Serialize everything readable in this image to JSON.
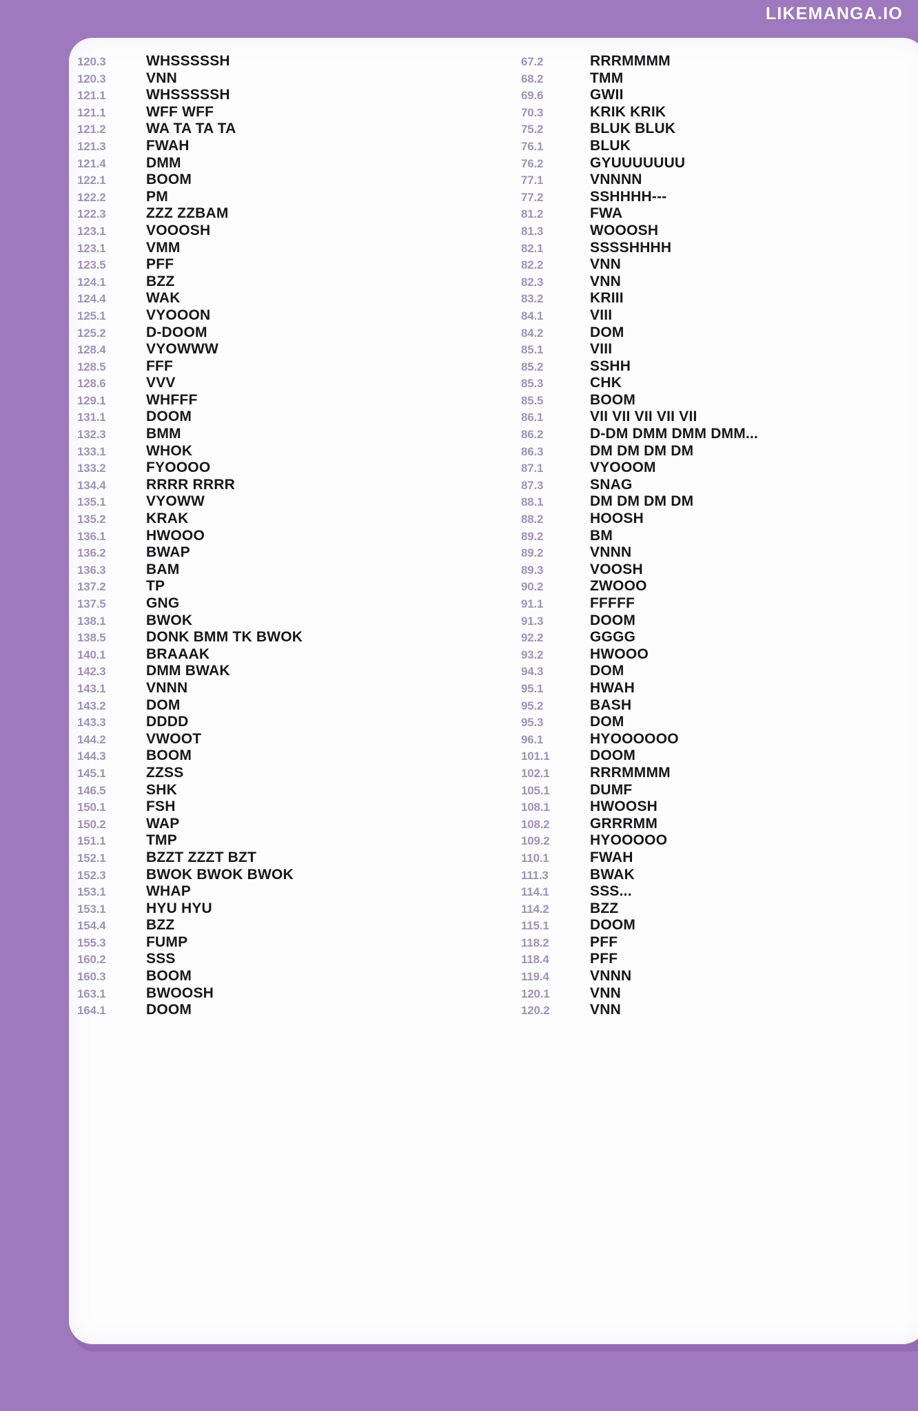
{
  "watermark": "LIKEMANGA.IO",
  "colors": {
    "background": "#9e79bd",
    "sheet": "#fdfdfd",
    "reference_text": "#9f93bb",
    "sfx_text": "#17171a",
    "watermark_text": "#ffffff"
  },
  "columns": {
    "left": [
      {
        "ref": "120.3",
        "sfx": "WHSSSSSH"
      },
      {
        "ref": "120.3",
        "sfx": "VNN"
      },
      {
        "ref": "121.1",
        "sfx": "WHSSSSSH"
      },
      {
        "ref": "121.1",
        "sfx": "WFF WFF"
      },
      {
        "ref": "121.2",
        "sfx": "WA TA TA TA"
      },
      {
        "ref": "121.3",
        "sfx": "FWAH"
      },
      {
        "ref": "121.4",
        "sfx": "DMM"
      },
      {
        "ref": "122.1",
        "sfx": "BOOM"
      },
      {
        "ref": "122.2",
        "sfx": "PM"
      },
      {
        "ref": "122.3",
        "sfx": "ZZZ ZZBAM"
      },
      {
        "ref": "123.1",
        "sfx": "VOOOSH"
      },
      {
        "ref": "123.1",
        "sfx": "VMM"
      },
      {
        "ref": "123.5",
        "sfx": "PFF"
      },
      {
        "ref": "124.1",
        "sfx": "BZZ"
      },
      {
        "ref": "124.4",
        "sfx": "WAK"
      },
      {
        "ref": "125.1",
        "sfx": "VYOOON"
      },
      {
        "ref": "125.2",
        "sfx": "D-DOOM"
      },
      {
        "ref": "128.4",
        "sfx": "VYOWWW"
      },
      {
        "ref": "128.5",
        "sfx": "FFF"
      },
      {
        "ref": "128.6",
        "sfx": "VVV"
      },
      {
        "ref": "129.1",
        "sfx": "WHFFF"
      },
      {
        "ref": "131.1",
        "sfx": "DOOM"
      },
      {
        "ref": "132.3",
        "sfx": "BMM"
      },
      {
        "ref": "133.1",
        "sfx": "WHOK"
      },
      {
        "ref": "133.2",
        "sfx": "FYOOOO"
      },
      {
        "ref": "134.4",
        "sfx": "RRRR RRRR"
      },
      {
        "ref": "135.1",
        "sfx": "VYOWW"
      },
      {
        "ref": "135.2",
        "sfx": "KRAK"
      },
      {
        "ref": "136.1",
        "sfx": "HWOOO"
      },
      {
        "ref": "136.2",
        "sfx": "BWAP"
      },
      {
        "ref": "136.3",
        "sfx": "BAM"
      },
      {
        "ref": "137.2",
        "sfx": "TP"
      },
      {
        "ref": "137.5",
        "sfx": "GNG"
      },
      {
        "ref": "138.1",
        "sfx": "BWOK"
      },
      {
        "ref": "138.5",
        "sfx": "DONK BMM TK BWOK"
      },
      {
        "ref": "140.1",
        "sfx": "BRAAAK"
      },
      {
        "ref": "142.3",
        "sfx": "DMM BWAK"
      },
      {
        "ref": "143.1",
        "sfx": "VNNN"
      },
      {
        "ref": "143.2",
        "sfx": "DOM"
      },
      {
        "ref": "143.3",
        "sfx": "DDDD"
      },
      {
        "ref": "144.2",
        "sfx": "VWOOT"
      },
      {
        "ref": "144.3",
        "sfx": "BOOM"
      },
      {
        "ref": "145.1",
        "sfx": "ZZSS"
      },
      {
        "ref": "146.5",
        "sfx": "SHK"
      },
      {
        "ref": "150.1",
        "sfx": "FSH"
      },
      {
        "ref": "150.2",
        "sfx": "WAP"
      },
      {
        "ref": "151.1",
        "sfx": "TMP"
      },
      {
        "ref": "152.1",
        "sfx": "BZZT ZZZT BZT"
      },
      {
        "ref": "152.3",
        "sfx": "BWOK BWOK BWOK"
      },
      {
        "ref": "153.1",
        "sfx": "WHAP"
      },
      {
        "ref": "153.1",
        "sfx": "HYU HYU"
      },
      {
        "ref": "154.4",
        "sfx": "BZZ"
      },
      {
        "ref": "155.3",
        "sfx": "FUMP"
      },
      {
        "ref": "160.2",
        "sfx": "SSS"
      },
      {
        "ref": "160.3",
        "sfx": "BOOM"
      },
      {
        "ref": "163.1",
        "sfx": "BWOOSH"
      },
      {
        "ref": "164.1",
        "sfx": "DOOM"
      }
    ],
    "right": [
      {
        "ref": "67.2",
        "sfx": "RRRMMMM"
      },
      {
        "ref": "68.2",
        "sfx": "TMM"
      },
      {
        "ref": "69.6",
        "sfx": "GWII"
      },
      {
        "ref": "70.3",
        "sfx": "KRIK KRIK"
      },
      {
        "ref": "75.2",
        "sfx": "BLUK BLUK"
      },
      {
        "ref": "76.1",
        "sfx": "BLUK"
      },
      {
        "ref": "76.2",
        "sfx": "GYUUUUUUU"
      },
      {
        "ref": "77.1",
        "sfx": "VNNNN"
      },
      {
        "ref": "77.2",
        "sfx": "SSHHHH---"
      },
      {
        "ref": "81.2",
        "sfx": "FWA"
      },
      {
        "ref": "81.3",
        "sfx": "WOOOSH"
      },
      {
        "ref": "82.1",
        "sfx": "SSSSHHHH"
      },
      {
        "ref": "82.2",
        "sfx": "VNN"
      },
      {
        "ref": "82.3",
        "sfx": "VNN"
      },
      {
        "ref": "83.2",
        "sfx": "KRIII"
      },
      {
        "ref": "84.1",
        "sfx": "VIII"
      },
      {
        "ref": "84.2",
        "sfx": "DOM"
      },
      {
        "ref": "85.1",
        "sfx": "VIII"
      },
      {
        "ref": "85.2",
        "sfx": "SSHH"
      },
      {
        "ref": "85.3",
        "sfx": "CHK"
      },
      {
        "ref": "85.5",
        "sfx": "BOOM"
      },
      {
        "ref": "86.1",
        "sfx": "VII VII VII VII VII"
      },
      {
        "ref": "86.2",
        "sfx": "D-DM DMM DMM DMM..."
      },
      {
        "ref": "86.3",
        "sfx": "DM DM DM DM"
      },
      {
        "ref": "87.1",
        "sfx": "VYOOOM"
      },
      {
        "ref": "87.3",
        "sfx": "SNAG"
      },
      {
        "ref": "88.1",
        "sfx": "DM DM DM DM"
      },
      {
        "ref": "88.2",
        "sfx": "HOOSH"
      },
      {
        "ref": "89.2",
        "sfx": "BM"
      },
      {
        "ref": "89.2",
        "sfx": "VNNN"
      },
      {
        "ref": "89.3",
        "sfx": "VOOSH"
      },
      {
        "ref": "90.2",
        "sfx": "ZWOOO"
      },
      {
        "ref": "91.1",
        "sfx": "FFFFF"
      },
      {
        "ref": "91.3",
        "sfx": "DOOM"
      },
      {
        "ref": "92.2",
        "sfx": "GGGG"
      },
      {
        "ref": "93.2",
        "sfx": "HWOOO"
      },
      {
        "ref": "94.3",
        "sfx": "DOM"
      },
      {
        "ref": "95.1",
        "sfx": "HWAH"
      },
      {
        "ref": "95.2",
        "sfx": "BASH"
      },
      {
        "ref": "95.3",
        "sfx": "DOM"
      },
      {
        "ref": "96.1",
        "sfx": "HYOOOOOO"
      },
      {
        "ref": "101.1",
        "sfx": "DOOM"
      },
      {
        "ref": "102.1",
        "sfx": "RRRMMMM"
      },
      {
        "ref": "105.1",
        "sfx": "DUMF"
      },
      {
        "ref": "108.1",
        "sfx": "HWOOSH"
      },
      {
        "ref": "108.2",
        "sfx": "GRRRMM"
      },
      {
        "ref": "109.2",
        "sfx": "HYOOOOO"
      },
      {
        "ref": "110.1",
        "sfx": "FWAH"
      },
      {
        "ref": "111.3",
        "sfx": "BWAK"
      },
      {
        "ref": "114.1",
        "sfx": "SSS..."
      },
      {
        "ref": "114.2",
        "sfx": "BZZ"
      },
      {
        "ref": "115.1",
        "sfx": "DOOM"
      },
      {
        "ref": "118.2",
        "sfx": "PFF"
      },
      {
        "ref": "118.4",
        "sfx": "PFF"
      },
      {
        "ref": "119.4",
        "sfx": "VNNN"
      },
      {
        "ref": "120.1",
        "sfx": "VNN"
      },
      {
        "ref": "120.2",
        "sfx": "VNN"
      }
    ]
  }
}
